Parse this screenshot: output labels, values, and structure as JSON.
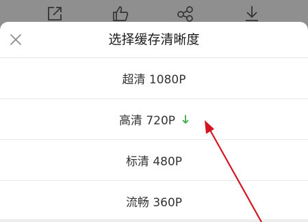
{
  "toolbar": {
    "icons": [
      "share-icon",
      "like-icon",
      "network-share-icon",
      "download-icon"
    ]
  },
  "sheet": {
    "title": "选择缓存清晰度",
    "close_icon": "close-icon",
    "options": [
      {
        "label": "超清 1080P",
        "downloaded": false
      },
      {
        "label": "高清 720P",
        "downloaded": true
      },
      {
        "label": "标清 480P",
        "downloaded": false
      },
      {
        "label": "流畅 360P",
        "downloaded": false
      }
    ]
  },
  "colors": {
    "overlay": "#8c8c8c",
    "download_mark": "#3aa843",
    "annotation_arrow": "#d4141e"
  }
}
